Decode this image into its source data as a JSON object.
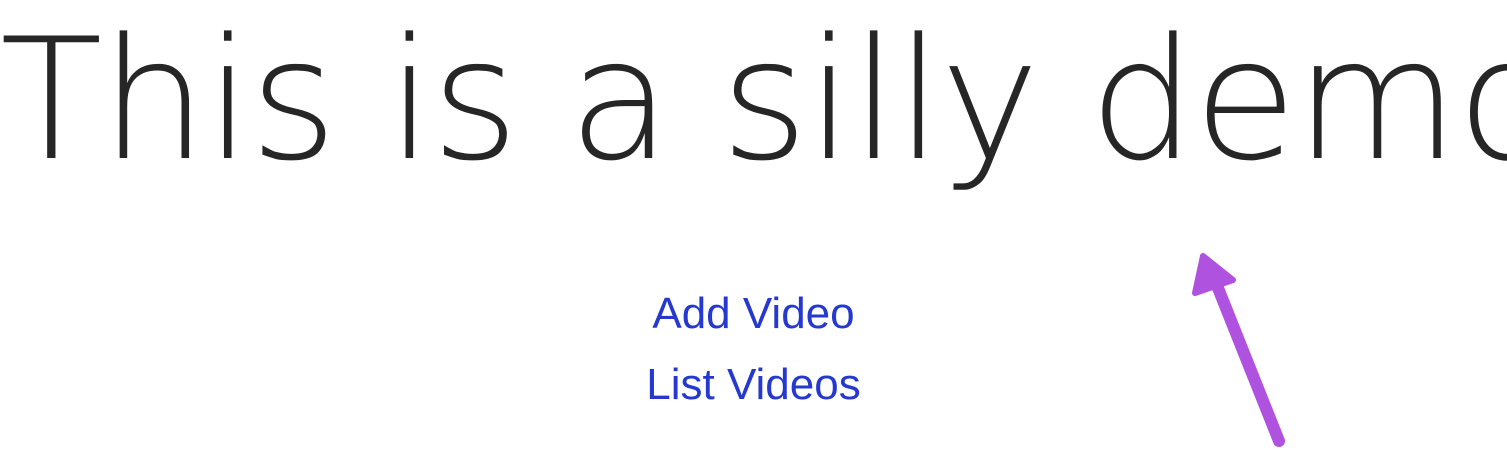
{
  "heading": {
    "text": "This is a silly demo"
  },
  "links": {
    "add_video": "Add Video",
    "list_videos": "List Videos"
  },
  "colors": {
    "heading": "#262626",
    "link": "#2538cf",
    "annotation_arrow": "#b052e0",
    "background": "#ffffff"
  }
}
